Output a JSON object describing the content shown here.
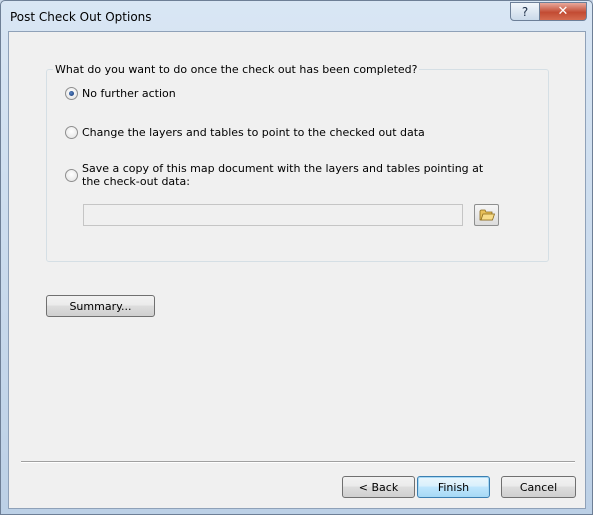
{
  "window": {
    "title": "Post Check Out Options",
    "help_label": "?",
    "close_label": "✕"
  },
  "group": {
    "legend": "What do you want to do once the check out has been completed?",
    "options": [
      {
        "label": "No further action",
        "checked": true
      },
      {
        "label": "Change the layers and tables to point to the checked out data",
        "checked": false
      },
      {
        "label_line1": "Save a copy of this map document with the layers and tables pointing at",
        "label_line2": "the check-out data:",
        "checked": false
      }
    ],
    "path_value": "",
    "browse_icon": "folder-open-icon"
  },
  "summary_button": "Summary...",
  "footer": {
    "back_label": "< Back",
    "finish_label": "Finish",
    "cancel_label": "Cancel"
  },
  "colors": {
    "close_button": "#c24b33",
    "default_button_border": "#3c7fb1"
  }
}
